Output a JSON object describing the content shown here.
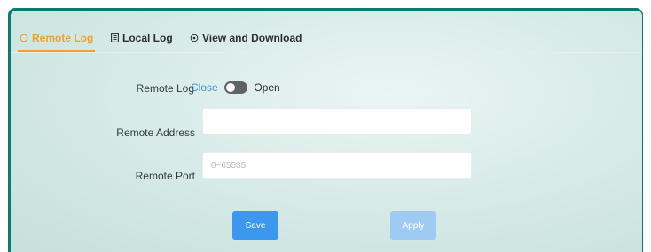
{
  "tabs": [
    {
      "label": "Remote Log",
      "icon": "circle-icon",
      "active": true
    },
    {
      "label": "Local Log",
      "icon": "document-icon",
      "active": false
    },
    {
      "label": "View and Download",
      "icon": "target-icon",
      "active": false
    }
  ],
  "form": {
    "remote_log": {
      "label": "Remote Log",
      "close_label": "Close",
      "open_label": "Open",
      "state": "off"
    },
    "remote_address": {
      "label": "Remote Address",
      "value": "",
      "placeholder": ""
    },
    "remote_port": {
      "label": "Remote Port",
      "value": "",
      "placeholder": "0~65535"
    }
  },
  "actions": {
    "save_label": "Save",
    "apply_label": "Apply"
  },
  "colors": {
    "accent": "#f0a032",
    "primary": "#3b98ee",
    "disabled": "#9fcaf4",
    "frame": "#0d7a70"
  }
}
